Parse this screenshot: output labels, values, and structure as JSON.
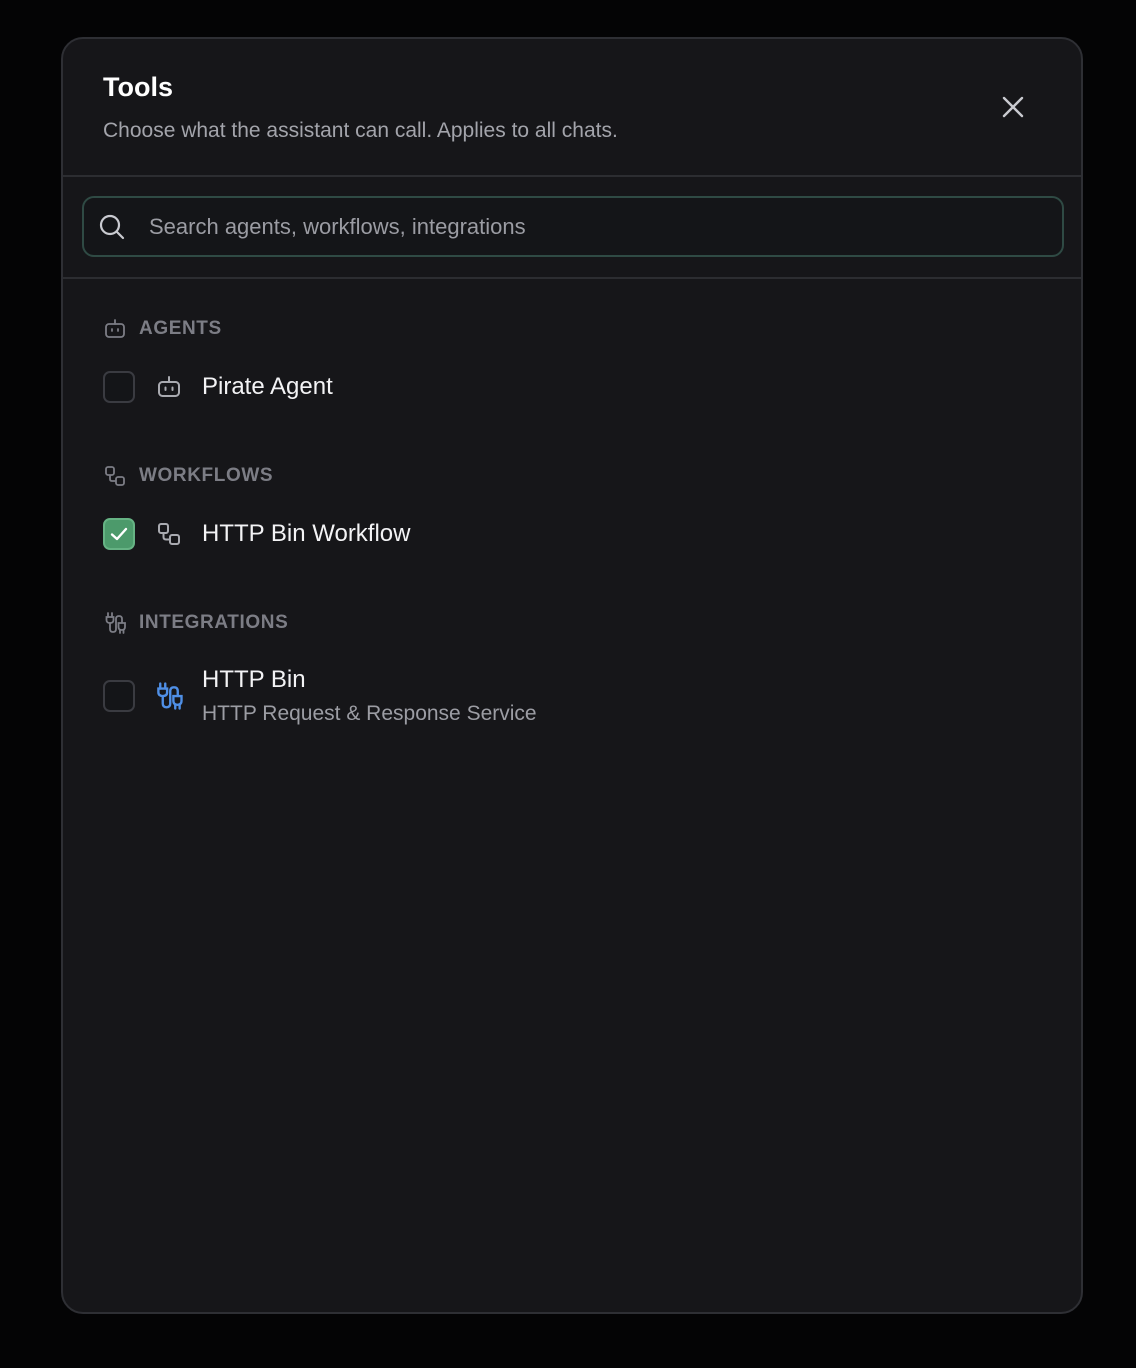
{
  "dialog": {
    "title": "Tools",
    "subtitle": "Choose what the assistant can call. Applies to all chats.",
    "close_icon": "close-icon"
  },
  "search": {
    "placeholder": "Search agents, workflows, integrations",
    "value": "",
    "icon": "search-icon"
  },
  "sections": {
    "agents": {
      "label": "AGENTS",
      "icon": "bot-icon",
      "items": [
        {
          "name": "Pirate Agent",
          "checked": false,
          "icon": "bot-icon"
        }
      ]
    },
    "workflows": {
      "label": "WORKFLOWS",
      "icon": "workflow-icon",
      "items": [
        {
          "name": "HTTP Bin Workflow",
          "checked": true,
          "icon": "workflow-icon"
        }
      ]
    },
    "integrations": {
      "label": "INTEGRATIONS",
      "icon": "plug-icon",
      "items": [
        {
          "name": "HTTP Bin",
          "description": "HTTP Request & Response Service",
          "checked": false,
          "icon": "plug-icon"
        }
      ]
    }
  },
  "colors": {
    "background": "#040405",
    "panel": "#161619",
    "accent_checked": "#4c9a6b",
    "integration_icon": "#4f8fe6",
    "muted": "#7c7d85"
  }
}
